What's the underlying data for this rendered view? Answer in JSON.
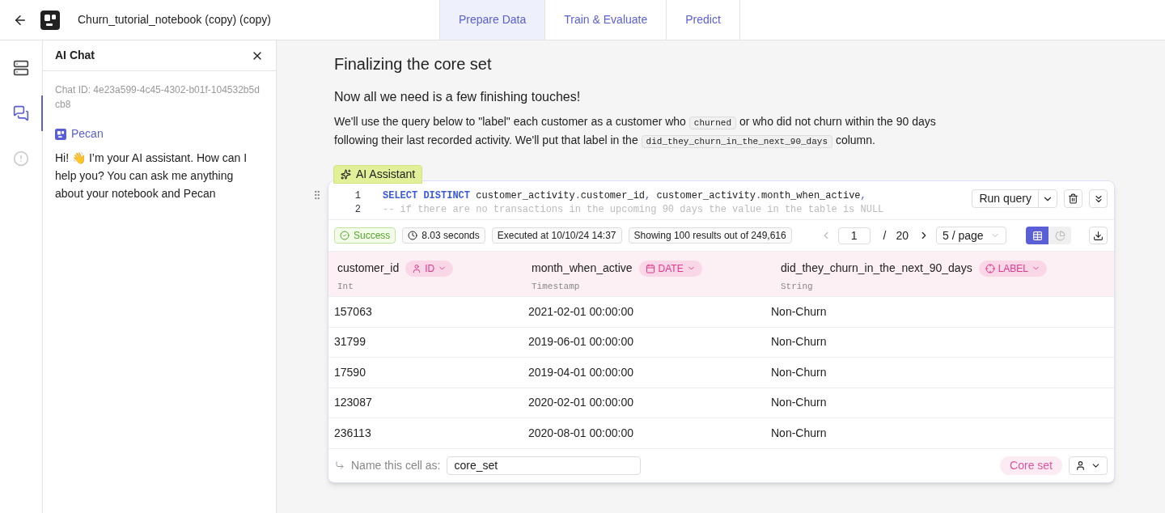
{
  "header": {
    "title": "Churn_tutorial_notebook (copy) (copy)"
  },
  "tabs": [
    {
      "label": "Prepare Data",
      "selected": true
    },
    {
      "label": "Train & Evaluate",
      "selected": false
    },
    {
      "label": "Predict",
      "selected": false
    }
  ],
  "rail": [
    {
      "kind": "data",
      "selected": false
    },
    {
      "kind": "chat",
      "selected": true
    },
    {
      "kind": "alert",
      "selected": false
    }
  ],
  "chat": {
    "title": "AI Chat",
    "chat_id": "Chat ID: 4e23a599-4c45-4302-b01f-104532b5dcb8",
    "sender": "Pecan",
    "message": "Hi! 👋 I’m your AI assistant. How can I help you? You can ask me anything about your notebook and Pecan"
  },
  "section": {
    "heading": "Finalizing the core set",
    "subheading": "Now all we need is a few finishing touches!",
    "paragraph": [
      {
        "kind": "text",
        "text": "We'll use the query below to \"label\" each customer as a customer who "
      },
      {
        "kind": "code",
        "text": "churned"
      },
      {
        "kind": "text",
        "text": " or who did not churn within the 90 days following their last recorded activity. We'll put that label in the "
      },
      {
        "kind": "code",
        "text": "did_they_churn_in_the_next_90_days"
      },
      {
        "kind": "text",
        "text": " column."
      }
    ]
  },
  "cell": {
    "assistant_tag": "AI Assistant",
    "code_lines": [
      {
        "number": "1",
        "tokens": [
          {
            "kind": "keyword",
            "text": "SELECT DISTINCT"
          },
          {
            "kind": "text",
            "text": " customer_activity"
          },
          {
            "kind": "punct",
            "text": "."
          },
          {
            "kind": "text",
            "text": "customer_id"
          },
          {
            "kind": "punct",
            "text": ","
          },
          {
            "kind": "text",
            "text": " customer_activity"
          },
          {
            "kind": "punct",
            "text": "."
          },
          {
            "kind": "text",
            "text": "month_when_active"
          },
          {
            "kind": "punct",
            "text": ","
          }
        ]
      },
      {
        "number": "2",
        "tokens": [
          {
            "kind": "comment",
            "text": "-- if there are no transactions in the upcoming 90 days the value in the table is NULL"
          }
        ]
      }
    ],
    "run_button": "Run query",
    "status": {
      "success": "Success",
      "duration": "8.03 seconds",
      "executed": "Executed at 10/10/24 14:37",
      "showing": "Showing 100 results out of 249,616"
    },
    "pagination": {
      "page": "1",
      "separator": "/",
      "total": "20",
      "page_size": "5 / page"
    },
    "views": [
      {
        "kind": "table",
        "selected": true
      },
      {
        "kind": "chart",
        "selected": false
      }
    ],
    "columns": [
      {
        "name": "customer_id",
        "type": "Int",
        "tag": "ID",
        "kind": "id"
      },
      {
        "name": "month_when_active",
        "type": "Timestamp",
        "tag": "DATE",
        "kind": "date"
      },
      {
        "name": "did_they_churn_in_the_next_90_days",
        "type": "String",
        "tag": "LABEL",
        "kind": "label"
      }
    ],
    "rows": [
      [
        "157063",
        "2021-02-01 00:00:00",
        "Non-Churn"
      ],
      [
        "31799",
        "2019-06-01 00:00:00",
        "Non-Churn"
      ],
      [
        "17590",
        "2019-04-01 00:00:00",
        "Non-Churn"
      ],
      [
        "123087",
        "2020-02-01 00:00:00",
        "Non-Churn"
      ],
      [
        "236113",
        "2020-08-01 00:00:00",
        "Non-Churn"
      ]
    ],
    "name_label": "Name this cell as:",
    "name_value": "core_set",
    "role_badge": "Core set"
  }
}
